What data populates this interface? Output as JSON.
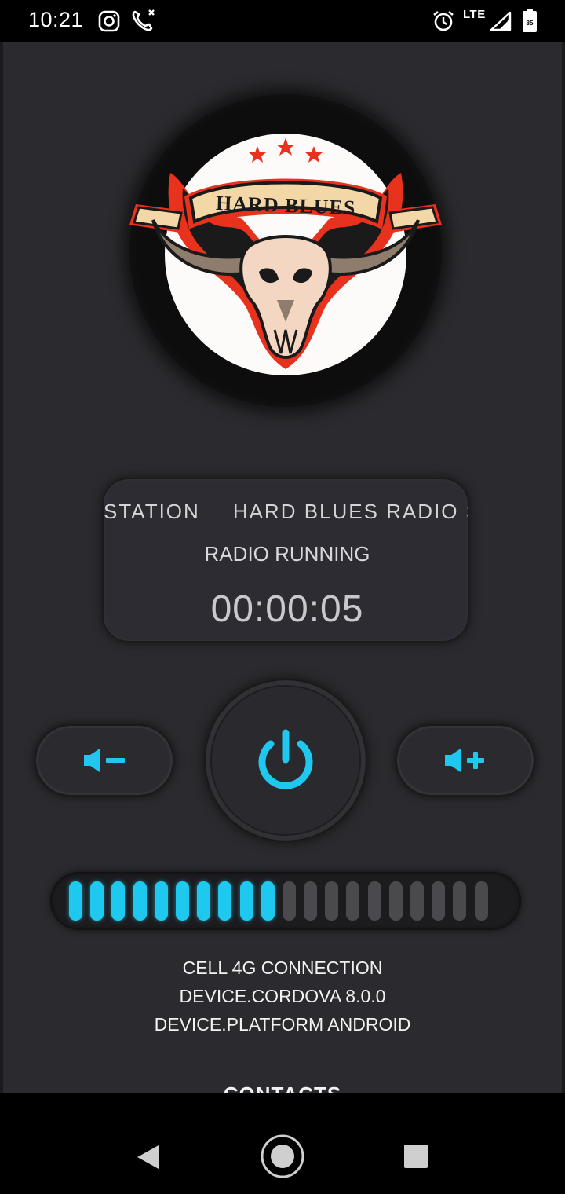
{
  "status_bar": {
    "time": "10:21",
    "network": "LTE",
    "battery": "85",
    "icons": [
      "instagram-icon",
      "missed-call-icon",
      "alarm-icon",
      "signal-icon",
      "battery-icon"
    ]
  },
  "logo": {
    "text": "HARD BLUES"
  },
  "player": {
    "marquee_text": [
      "STATION",
      "HARD BLUES RADIO STATION"
    ],
    "status": "RADIO RUNNING",
    "timer": "00:00:05"
  },
  "controls": {
    "volume_down_icon": "volume-down-icon",
    "power_icon": "power-icon",
    "volume_up_icon": "volume-up-icon"
  },
  "volume": {
    "level": 10,
    "max": 20
  },
  "device_info": {
    "connection": "CELL 4G CONNECTION",
    "cordova": "DEVICE.CORDOVA 8.0.0",
    "platform": "DEVICE.PLATFORM ANDROID"
  },
  "contacts": {
    "heading": "CONTACTS"
  },
  "colors": {
    "accent": "#1ec8ee",
    "background": "#2b2b2f",
    "logo_red": "#e8321e"
  }
}
